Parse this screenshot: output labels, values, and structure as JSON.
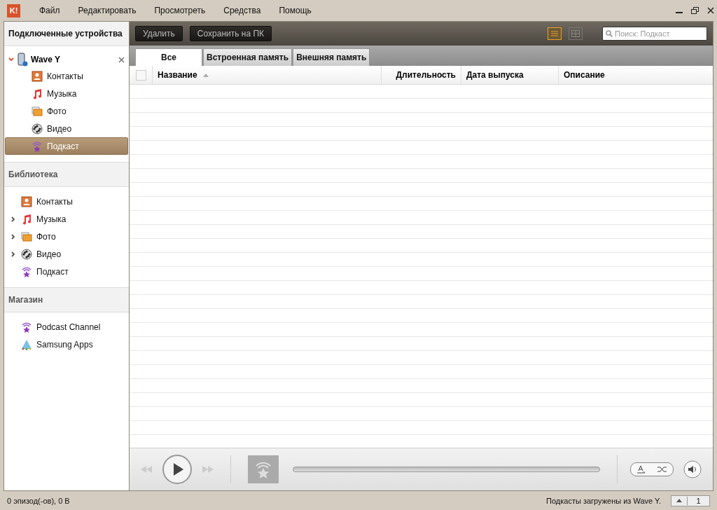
{
  "app": {
    "logo": "K!"
  },
  "menu": [
    "Файл",
    "Редактировать",
    "Просмотреть",
    "Средства",
    "Помощь"
  ],
  "sidebar": {
    "devices": {
      "title": "Подключенные устройства",
      "device": {
        "name": "Wave Y",
        "expanded": true
      },
      "items": [
        {
          "label": "Контакты",
          "kind": "contacts",
          "selected": false
        },
        {
          "label": "Музыка",
          "kind": "music",
          "selected": false
        },
        {
          "label": "Фото",
          "kind": "photo",
          "selected": false
        },
        {
          "label": "Видео",
          "kind": "video",
          "selected": false
        },
        {
          "label": "Подкаст",
          "kind": "podcast",
          "selected": true
        }
      ]
    },
    "sections": [
      {
        "title": "Библиотека",
        "items": [
          {
            "label": "Контакты",
            "kind": "contacts",
            "collapsed": false
          },
          {
            "label": "Музыка",
            "kind": "music",
            "collapsed": true
          },
          {
            "label": "Фото",
            "kind": "photo",
            "collapsed": true
          },
          {
            "label": "Видео",
            "kind": "video",
            "collapsed": true
          },
          {
            "label": "Подкаст",
            "kind": "podcast",
            "collapsed": false
          }
        ]
      },
      {
        "title": "Магазин",
        "items": [
          {
            "label": "Podcast Channel",
            "kind": "podcast",
            "collapsed": false
          },
          {
            "label": "Samsung Apps",
            "kind": "apps",
            "collapsed": false
          }
        ]
      }
    ]
  },
  "toolbar": {
    "buttons": [
      "Удалить",
      "Сохранить на ПК"
    ],
    "views": [
      {
        "kind": "list",
        "selected": true
      },
      {
        "kind": "grid",
        "selected": false
      }
    ],
    "search": {
      "placeholder": "Поиск: Подкаст"
    }
  },
  "tabs": [
    {
      "label": "Все",
      "selected": true
    },
    {
      "label": "Встроенная память",
      "selected": false
    },
    {
      "label": "Внешняя память",
      "selected": false
    }
  ],
  "table": {
    "select_all": {
      "checked": false
    },
    "columns": [
      "Название",
      "Длительность",
      "Дата выпуска",
      "Описание"
    ]
  },
  "status_bar": {
    "left": "0 эпизод(-ов), 0 B",
    "right": "Подкасты загружены из Wave Y.",
    "page": "1"
  }
}
